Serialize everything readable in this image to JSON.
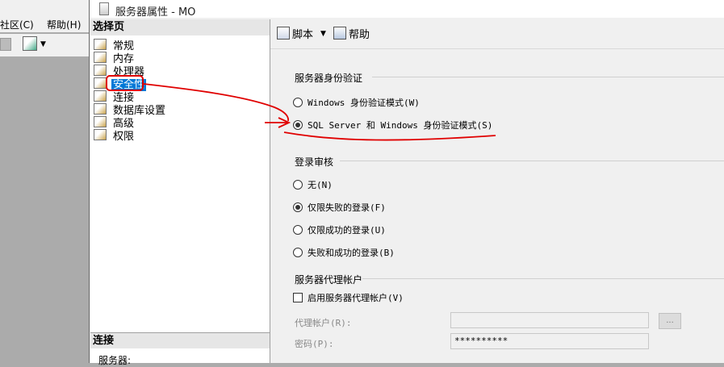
{
  "background_app": {
    "menu": [
      "社区(C)",
      "帮助(H)"
    ]
  },
  "dialog": {
    "title": "服务器属性 - MO",
    "left_pane": {
      "header": "选择页",
      "items": [
        {
          "label": "常规",
          "selected": false
        },
        {
          "label": "内存",
          "selected": false
        },
        {
          "label": "处理器",
          "selected": false
        },
        {
          "label": "安全性",
          "selected": true
        },
        {
          "label": "连接",
          "selected": false
        },
        {
          "label": "数据库设置",
          "selected": false
        },
        {
          "label": "高级",
          "selected": false
        },
        {
          "label": "权限",
          "selected": false
        }
      ],
      "connection_header": "连接",
      "server_label": "服务器:"
    },
    "toolbar": {
      "script_label": "脚本",
      "help_label": "帮助"
    },
    "auth": {
      "title": "服务器身份验证",
      "windows_option": "Windows 身份验证模式(W)",
      "mixed_option": "SQL Server 和 Windows 身份验证模式(S)",
      "selected": "mixed"
    },
    "audit": {
      "title": "登录审核",
      "options": [
        {
          "label": "无(N)",
          "selected": false
        },
        {
          "label": "仅限失败的登录(F)",
          "selected": true
        },
        {
          "label": "仅限成功的登录(U)",
          "selected": false
        },
        {
          "label": "失败和成功的登录(B)",
          "selected": false
        }
      ]
    },
    "proxy": {
      "title": "服务器代理帐户",
      "enable_label": "启用服务器代理帐户(V)",
      "enabled": false,
      "account_label": "代理帐户(R):",
      "account_value": "",
      "password_label": "密码(P):",
      "password_value": "**********",
      "browse_label": "..."
    }
  },
  "colors": {
    "selection": "#0078d7",
    "annotation": "#e00000"
  }
}
